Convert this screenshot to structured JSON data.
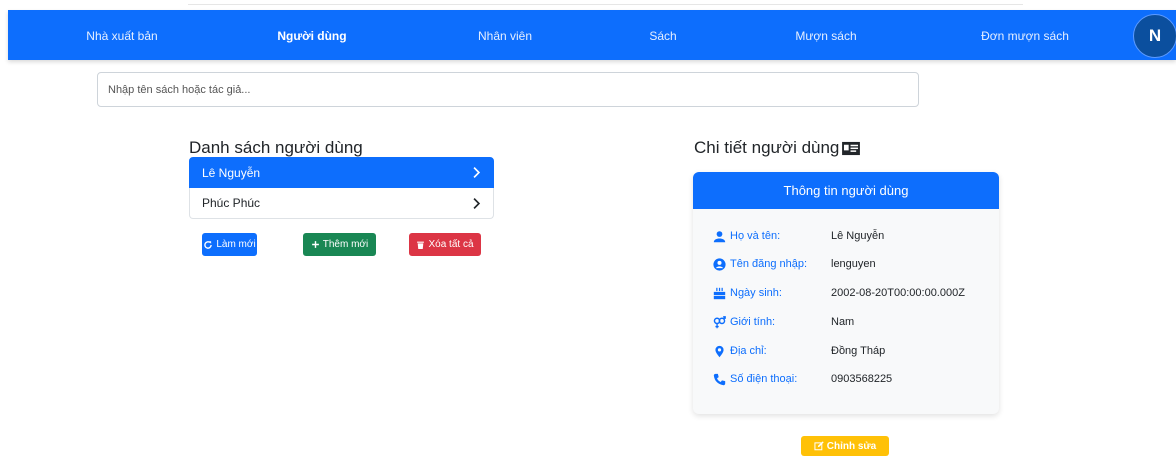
{
  "nav": {
    "items": [
      {
        "label": "Nhà xuất bản",
        "active": false
      },
      {
        "label": "Người dùng",
        "active": true
      },
      {
        "label": "Nhân viên",
        "active": false
      },
      {
        "label": "Sách",
        "active": false
      },
      {
        "label": "Mượn sách",
        "active": false
      },
      {
        "label": "Đơn mượn sách",
        "active": false
      }
    ],
    "avatar": "N"
  },
  "search": {
    "placeholder": "Nhập tên sách hoặc tác giả...",
    "value": ""
  },
  "user_list": {
    "title": "Danh sách người dùng",
    "items": [
      "Lê Nguyễn",
      "Phúc Phúc"
    ],
    "selected_index": 0,
    "buttons": {
      "refresh": "Làm mới",
      "add": "Thêm mới",
      "delete_all": "Xóa tất cả"
    }
  },
  "detail": {
    "title": "Chi tiết người dùng",
    "card_title": "Thông tin người dùng",
    "fields": [
      {
        "icon": "user-icon",
        "label": "Họ và tên:",
        "value": "Lê Nguyễn"
      },
      {
        "icon": "user-circle-icon",
        "label": "Tên đăng nhập:",
        "value": "lenguyen"
      },
      {
        "icon": "birthday-cake-icon",
        "label": "Ngày sinh:",
        "value": "2002-08-20T00:00:00.000Z"
      },
      {
        "icon": "gender-icon",
        "label": "Giới tính:",
        "value": "Nam"
      },
      {
        "icon": "map-marker-icon",
        "label": "Địa chỉ:",
        "value": "Đồng Tháp"
      },
      {
        "icon": "phone-icon",
        "label": "Số điện thoại:",
        "value": "0903568225"
      }
    ],
    "edit_button": "Chỉnh sửa"
  },
  "colors": {
    "primary": "#0d6efd",
    "success": "#198754",
    "danger": "#dc3545",
    "warning": "#ffc107"
  }
}
